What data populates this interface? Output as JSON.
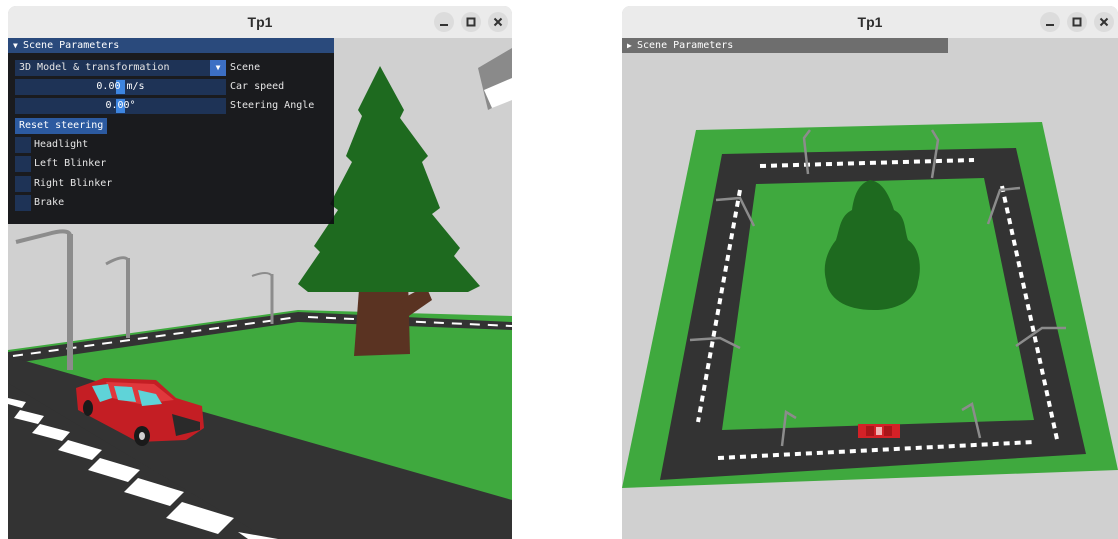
{
  "windows": [
    {
      "title": "Tp1",
      "panel": {
        "header": "Scene Parameters",
        "expanded": true,
        "scene_combo": {
          "value": "3D Model & transformation",
          "label": "Scene"
        },
        "car_speed": {
          "value": "0.00 m/s",
          "label": "Car speed",
          "fraction": 0.5
        },
        "steering_angle": {
          "value": "0.00°",
          "label": "Steering Angle",
          "fraction": 0.5
        },
        "reset_button": "Reset steering",
        "checkboxes": [
          {
            "label": "Headlight",
            "checked": false
          },
          {
            "label": "Left Blinker",
            "checked": false
          },
          {
            "label": "Right Blinker",
            "checked": false
          },
          {
            "label": "Brake",
            "checked": false
          }
        ]
      }
    },
    {
      "title": "Tp1",
      "panel": {
        "header": "Scene Parameters",
        "expanded": false
      }
    }
  ],
  "icons": {
    "minimize": "minimize-icon",
    "maximize": "maximize-icon",
    "close": "close-icon"
  },
  "colors": {
    "grass": "#3fa93e",
    "road": "#333333",
    "sky": "#d0d0d0",
    "car": "#d42127",
    "tree_foliage": "#1e6a1f",
    "tree_trunk": "#5a3322",
    "imgui_header": "#2a4a7c",
    "imgui_frame": "#1e3356",
    "imgui_slider": "#3d85e0"
  }
}
